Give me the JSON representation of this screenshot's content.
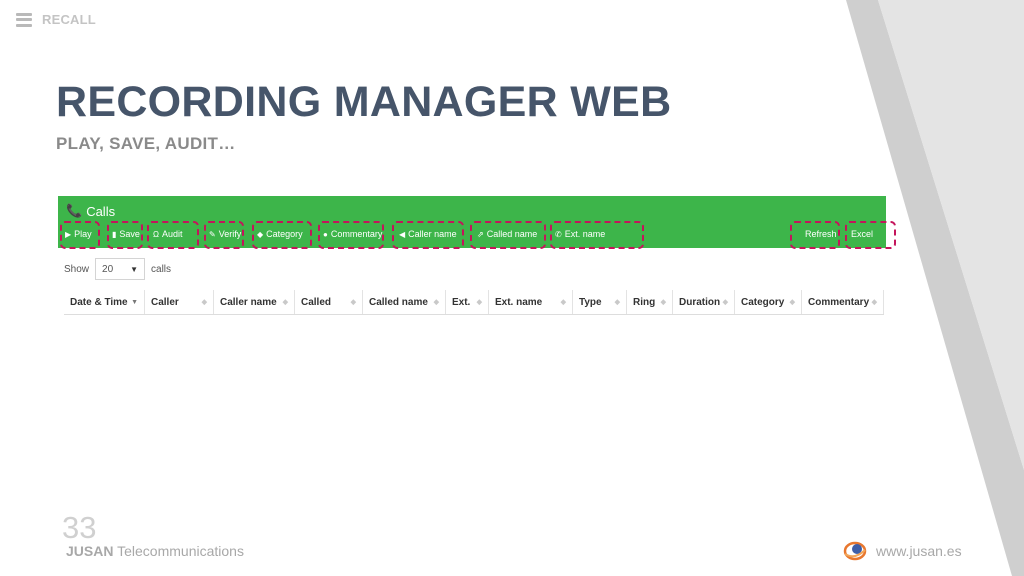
{
  "header": {
    "brand": "RECALL"
  },
  "slide": {
    "title": "RECORDING MANAGER WEB",
    "subtitle": "PLAY, SAVE, AUDIT…"
  },
  "panel": {
    "title": "Calls",
    "toolbar": [
      {
        "label": "Play",
        "icon": "play-icon"
      },
      {
        "label": "Save",
        "icon": "file-icon"
      },
      {
        "label": "Audit",
        "icon": "headphones-icon"
      },
      {
        "label": "Verify",
        "icon": "pencil-icon"
      },
      {
        "label": "Category",
        "icon": "tag-icon"
      },
      {
        "label": "Commentary",
        "icon": "comment-icon"
      },
      {
        "label": "Caller name",
        "icon": "speaker-icon"
      },
      {
        "label": "Called name",
        "icon": "share-icon"
      },
      {
        "label": "Ext. name",
        "icon": "phone-icon"
      }
    ],
    "refresh_label": "Refresh",
    "excel_label": "Excel",
    "show_label": "Show",
    "page_size": "20",
    "calls_label": "calls",
    "columns": [
      "Date & Time",
      "Caller",
      "Caller name",
      "Called",
      "Called name",
      "Ext.",
      "Ext. name",
      "Type",
      "Ring",
      "Duration",
      "Category",
      "Commentary"
    ]
  },
  "footer": {
    "page_number": "33",
    "company_bold": "JUSAN",
    "company_rest": "Telecommunications",
    "website": "www.jusan.es"
  },
  "colors": {
    "accent_green": "#3db54a",
    "highlight": "#c4145b",
    "title": "#46556a"
  }
}
